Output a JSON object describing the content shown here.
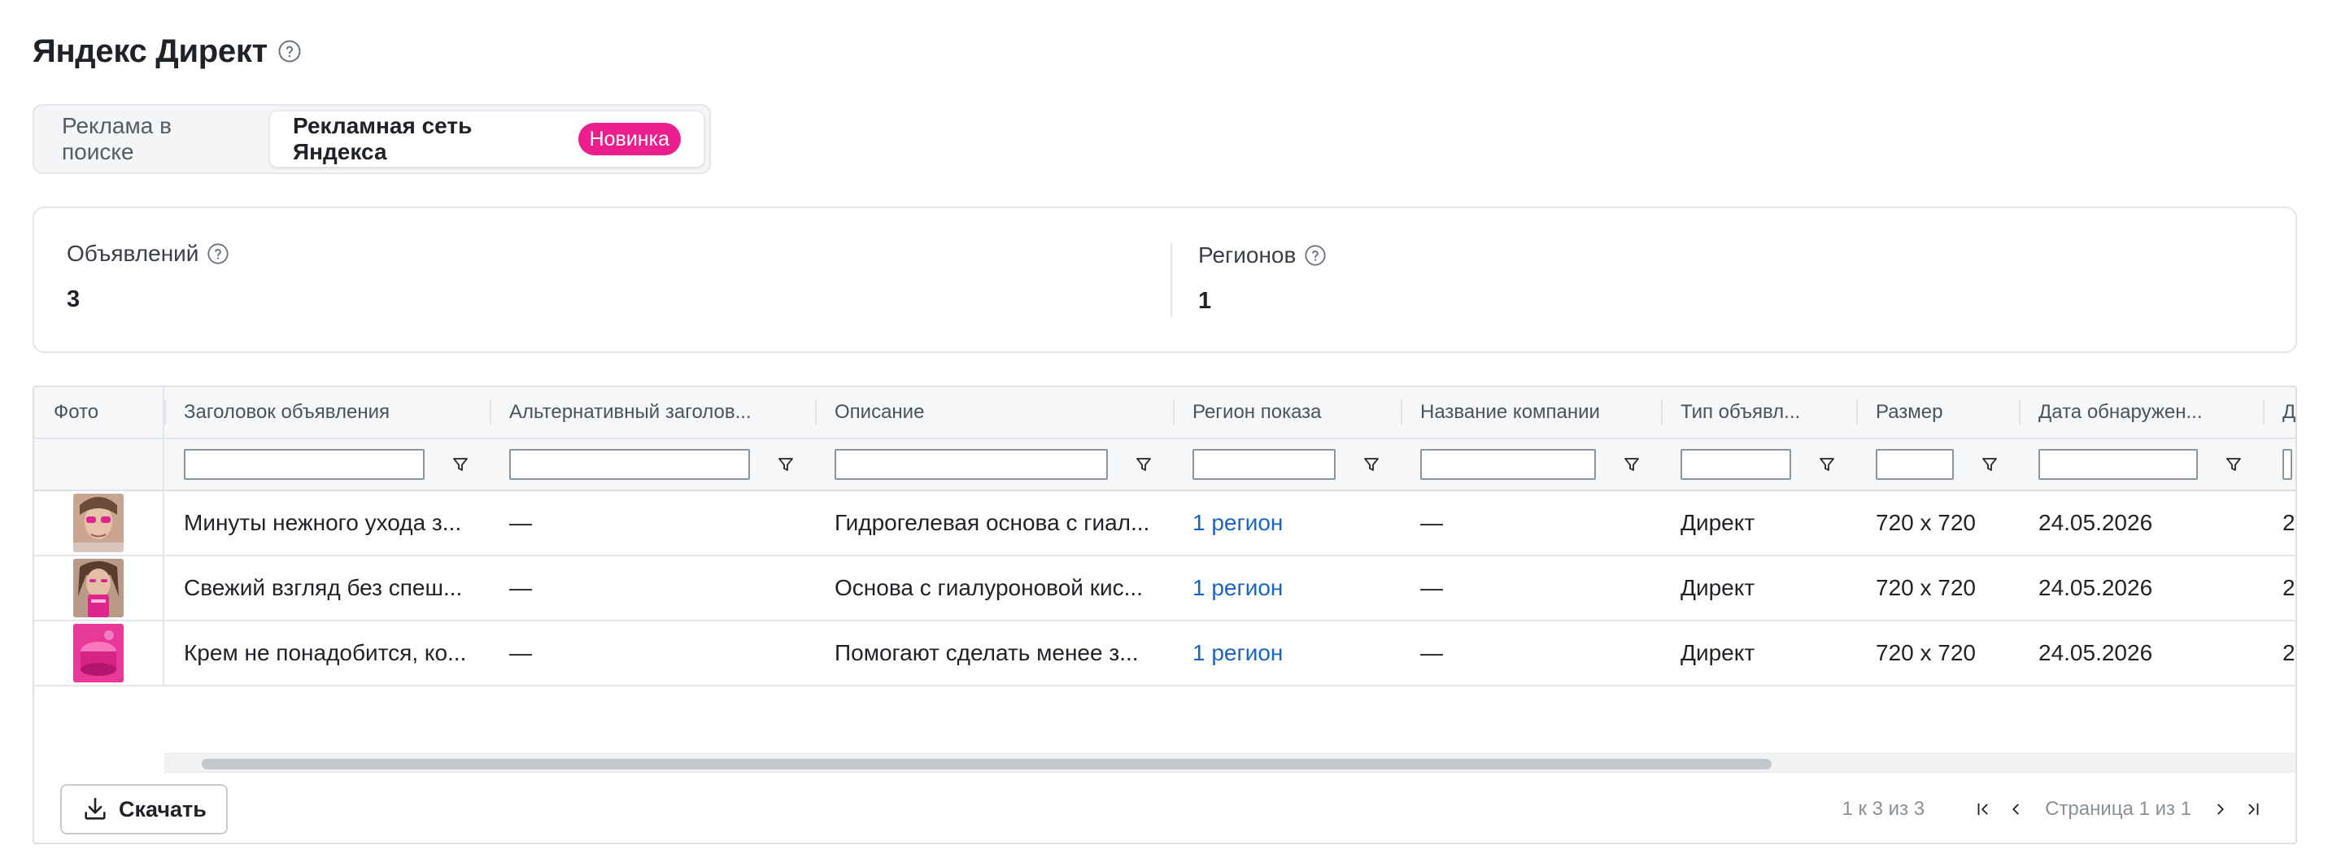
{
  "page": {
    "title": "Яндекс Директ"
  },
  "tabs": [
    {
      "label": "Реклама в поиске",
      "active": false
    },
    {
      "label": "Рекламная сеть Яндекса",
      "active": true,
      "badge": "Новинка"
    }
  ],
  "stats": [
    {
      "label": "Объявлений",
      "value": "3"
    },
    {
      "label": "Регионов",
      "value": "1"
    }
  ],
  "table": {
    "columns": [
      "Фото",
      "Заголовок объявления",
      "Альтернативный заголов...",
      "Описание",
      "Регион показа",
      "Название компании",
      "Тип объявл...",
      "Размер",
      "Дата обнаружен...",
      "Д"
    ],
    "rows": [
      {
        "photo": "photo-1",
        "title": "Минуты нежного ухода з...",
        "alt_title": "—",
        "description": "Гидрогелевая основа с гиал...",
        "region": "1 регион",
        "company": "—",
        "type": "Директ",
        "size": "720 x 720",
        "date": "24.05.2026",
        "extra": "2"
      },
      {
        "photo": "photo-2",
        "title": "Свежий взгляд без спеш...",
        "alt_title": "—",
        "description": "Основа с гиалуроновой кис...",
        "region": "1 регион",
        "company": "—",
        "type": "Директ",
        "size": "720 x 720",
        "date": "24.05.2026",
        "extra": "2"
      },
      {
        "photo": "photo-3",
        "title": "Крем не понадобится, ко...",
        "alt_title": "—",
        "description": "Помогают сделать менее з...",
        "region": "1 регион",
        "company": "—",
        "type": "Директ",
        "size": "720 x 720",
        "date": "24.05.2026",
        "extra": "2"
      }
    ]
  },
  "footer": {
    "download_label": "Скачать",
    "summary": "1 к 3 из 3",
    "page_text": "Страница 1 из 1"
  },
  "colors": {
    "accent_pink": "#ec1d8c",
    "link_blue": "#1a64c4"
  },
  "icons": [
    "help-icon",
    "filter-icon",
    "download-icon",
    "first-page-icon",
    "prev-page-icon",
    "next-page-icon",
    "last-page-icon"
  ]
}
